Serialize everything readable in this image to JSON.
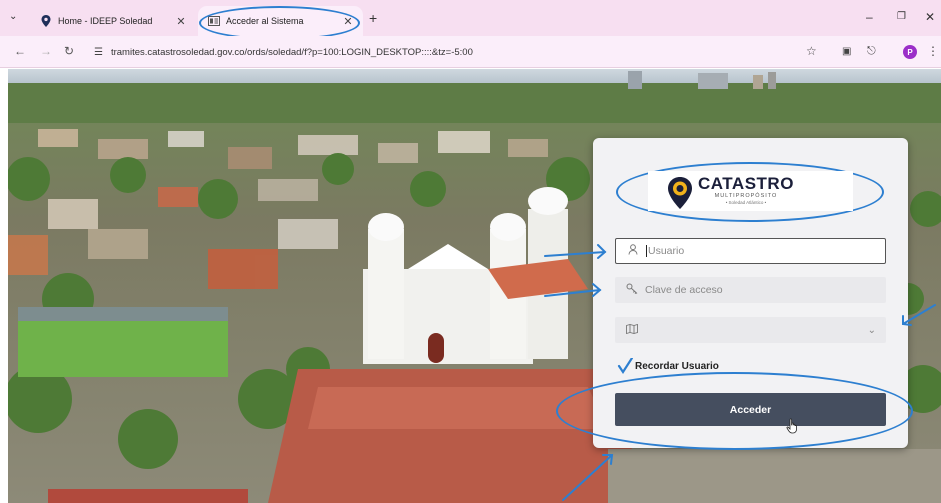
{
  "browser": {
    "tabs": [
      {
        "title": "Home - IDEEP Soledad",
        "active": false,
        "icon": "map-pin-icon"
      },
      {
        "title": "Acceder al Sistema",
        "active": true,
        "icon": "app-favicon-icon"
      }
    ],
    "url": "tramites.catastrosoledad.gov.co/ords/soledad/f?p=100:LOGIN_DESKTOP::::&tz=-5:00",
    "profile_initial": "P"
  },
  "login": {
    "logo": {
      "title": "CATASTRO",
      "subtitle": "MULTIPROPÓSITO",
      "caption": "• Soledad Atlántico •"
    },
    "username": {
      "placeholder": "Usuario",
      "icon": "user-icon"
    },
    "password": {
      "placeholder": "Clave de acceso",
      "icon": "key-icon"
    },
    "map_select": {
      "value": "",
      "icon": "map-icon"
    },
    "remember": {
      "label": "Recordar Usuario",
      "checked": true
    },
    "submit_label": "Acceder"
  },
  "colors": {
    "tabbar": "#f7dff1",
    "annotation": "#2d7fd0",
    "submit_button": "#454e5f",
    "logo_accent": "#f2b21b"
  }
}
